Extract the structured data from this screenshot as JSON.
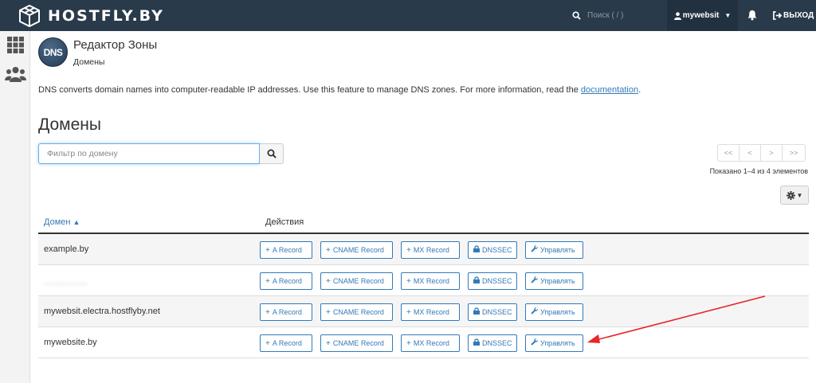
{
  "topbar": {
    "logo_text": "HOSTFLY.BY",
    "search_placeholder": "Поиск ( / )",
    "username": "mywebsit",
    "logout_label": "ВЫХОД"
  },
  "header": {
    "badge_text": "DNS",
    "title": "Редактор Зоны",
    "subtitle": "Домены"
  },
  "description": {
    "text": "DNS converts domain names into computer-readable IP addresses. Use this feature to manage DNS zones. For more information, read the ",
    "link_text": "documentation",
    "suffix": "."
  },
  "section_title": "Домены",
  "filter": {
    "placeholder": "Фильтр по домену"
  },
  "pagination": {
    "buttons": [
      "<<",
      "<",
      ">",
      ">>"
    ],
    "info": "Показано 1–4 из 4 элементов"
  },
  "table": {
    "columns": {
      "domain": "Домен",
      "actions": "Действия"
    },
    "action_labels": {
      "a_record": "A Record",
      "cname_record": "CNAME Record",
      "mx_record": "MX Record",
      "dnssec": "DNSSEC",
      "manage": "Управлять"
    },
    "rows": [
      {
        "domain": "example.by"
      },
      {
        "domain": ""
      },
      {
        "domain": "mywebsit.electra.hostflyby.net"
      },
      {
        "domain": "mywebsite.by"
      }
    ]
  },
  "colors": {
    "topbar": "#293a4a",
    "link": "#337ab7",
    "annotation_arrow": "#e8262b"
  }
}
